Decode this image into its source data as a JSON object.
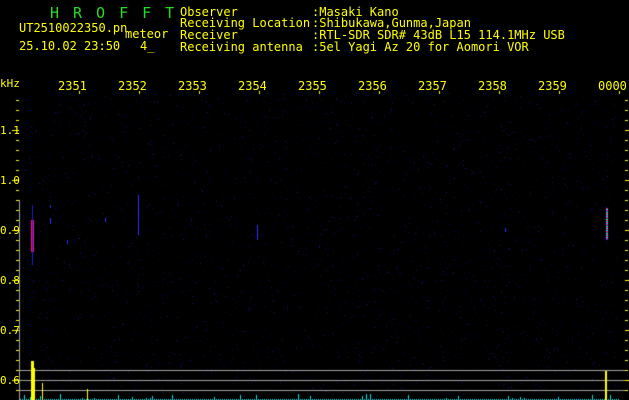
{
  "app_title": "HROFFT",
  "file_name": "UT2510022350.pn",
  "mode_label": "meteor",
  "datetime": "25.10.02 23:50",
  "count": "4_",
  "info": [
    {
      "label": "Observer",
      "value": ":Masaki Kano"
    },
    {
      "label": "Receiving Location",
      "value": ":Shibukawa,Gunma,Japan"
    },
    {
      "label": "Receiver",
      "value": ":RTL-SDR SDR# 43dB L15 114.1MHz USB"
    },
    {
      "label": "Receiving antenna",
      "value": ":5el Yagi Az 20 for Aomori VOR"
    }
  ],
  "y_unit": "kHz",
  "time_labels": [
    "2351",
    "2352",
    "2353",
    "2354",
    "2355",
    "2356",
    "2357",
    "2358",
    "2359",
    "0000"
  ],
  "freq_labels": [
    "1.1",
    "1.0",
    "0.9",
    "0.8",
    "0.7",
    "0.6"
  ],
  "colors": {
    "text": "#ffff00",
    "title": "#22dd22",
    "noise": "#0a0a50",
    "grid": "#a0a0a0",
    "level": "#00e0e0"
  }
}
